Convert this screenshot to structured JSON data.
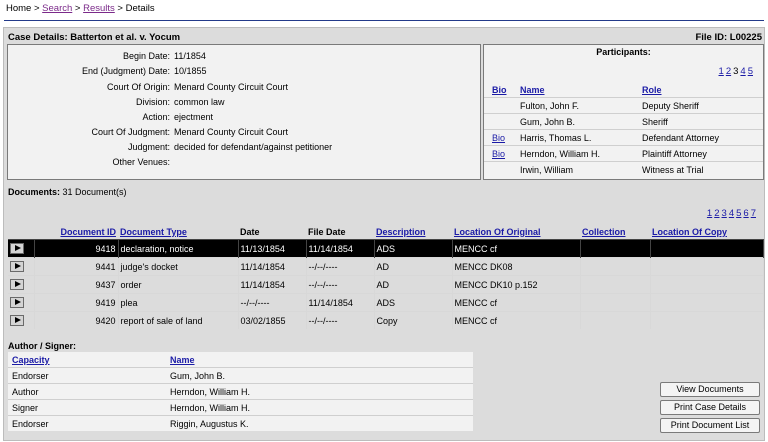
{
  "breadcrumb": {
    "home": "Home",
    "sep1": " > ",
    "search": "Search",
    "sep2": " > ",
    "results": "Results",
    "sep3": " > ",
    "details": "Details"
  },
  "case": {
    "title": "Case Details: Batterton et al. v. Yocum",
    "file_id": "File ID: L00225",
    "fields": [
      {
        "label": "Begin Date:",
        "value": "11/1854"
      },
      {
        "label": "End (Judgment) Date:",
        "value": "10/1855"
      },
      {
        "label": "Court Of Origin:",
        "value": "Menard County Circuit Court"
      },
      {
        "label": "Division:",
        "value": "common law"
      },
      {
        "label": "Action:",
        "value": "ejectment"
      },
      {
        "label": "Court Of Judgment:",
        "value": "Menard County Circuit Court"
      },
      {
        "label": "Judgment:",
        "value": "decided for defendant/against petitioner"
      },
      {
        "label": "Other Venues:",
        "value": ""
      }
    ]
  },
  "participants": {
    "title": "Participants:",
    "pages": [
      "1",
      "2",
      "3",
      "4",
      "5"
    ],
    "current_page": "3",
    "headers": {
      "bio": "Bio",
      "name": "Name",
      "role": "Role"
    },
    "rows": [
      {
        "bio": "",
        "name": "Fulton, John F.",
        "role": "Deputy Sheriff"
      },
      {
        "bio": "",
        "name": "Gum, John B.",
        "role": "Sheriff"
      },
      {
        "bio": "Bio",
        "name": "Harris, Thomas L.",
        "role": "Defendant Attorney"
      },
      {
        "bio": "Bio",
        "name": "Herndon, William H.",
        "role": "Plaintiff Attorney"
      },
      {
        "bio": "",
        "name": "Irwin, William",
        "role": "Witness at Trial"
      }
    ]
  },
  "documents": {
    "label": "Documents:",
    "count": "31 Document(s)",
    "pages": [
      "1",
      "2",
      "3",
      "4",
      "5",
      "6",
      "7"
    ],
    "headers": {
      "id": "Document ID",
      "type": "Document Type",
      "date": "Date",
      "file_date": "File Date",
      "description": "Description",
      "location": "Location Of Original",
      "collection": "Collection",
      "copy": "Location Of Copy"
    },
    "rows": [
      {
        "id": "9418",
        "type": "declaration, notice",
        "date": "11/13/1854",
        "file_date": "11/14/1854",
        "description": "ADS",
        "location": "MENCC cf",
        "collection": "",
        "copy": "",
        "selected": true
      },
      {
        "id": "9441",
        "type": "judge's docket",
        "date": "11/14/1854",
        "file_date": "--/--/----",
        "description": "AD",
        "location": "MENCC DK08",
        "collection": "",
        "copy": ""
      },
      {
        "id": "9437",
        "type": "order",
        "date": "11/14/1854",
        "file_date": "--/--/----",
        "description": "AD",
        "location": "MENCC DK10 p.152",
        "collection": "",
        "copy": ""
      },
      {
        "id": "9419",
        "type": "plea",
        "date": "--/--/----",
        "file_date": "11/14/1854",
        "description": "ADS",
        "location": "MENCC cf",
        "collection": "",
        "copy": ""
      },
      {
        "id": "9420",
        "type": "report of sale of land",
        "date": "03/02/1855",
        "file_date": "--/--/----",
        "description": "Copy",
        "location": "MENCC cf",
        "collection": "",
        "copy": ""
      }
    ]
  },
  "authors": {
    "label": "Author / Signer:",
    "headers": {
      "capacity": "Capacity",
      "name": "Name"
    },
    "rows": [
      {
        "capacity": "Endorser",
        "name": "Gum, John B."
      },
      {
        "capacity": "Author",
        "name": "Herndon, William H."
      },
      {
        "capacity": "Signer",
        "name": "Herndon, William H."
      },
      {
        "capacity": "Endorser",
        "name": "Riggin, Augustus K."
      }
    ]
  },
  "buttons": {
    "view": "View Documents",
    "print_case": "Print Case Details",
    "print_docs": "Print Document List"
  }
}
